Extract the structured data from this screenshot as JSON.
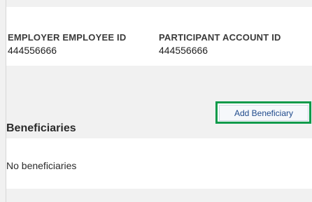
{
  "participant_ids": [
    {
      "label": "EMPLOYER EMPLOYEE ID",
      "value": "444556666"
    },
    {
      "label": "PARTICIPANT ACCOUNT ID",
      "value": "444556666"
    }
  ],
  "beneficiaries": {
    "title": "Beneficiaries",
    "add_button_label": "Add Beneficiary",
    "empty_message": "No beneficiaries"
  },
  "colors": {
    "highlight": "#0a9a4a",
    "button_text": "#1f4a8c",
    "background": "#f1f1f1"
  }
}
